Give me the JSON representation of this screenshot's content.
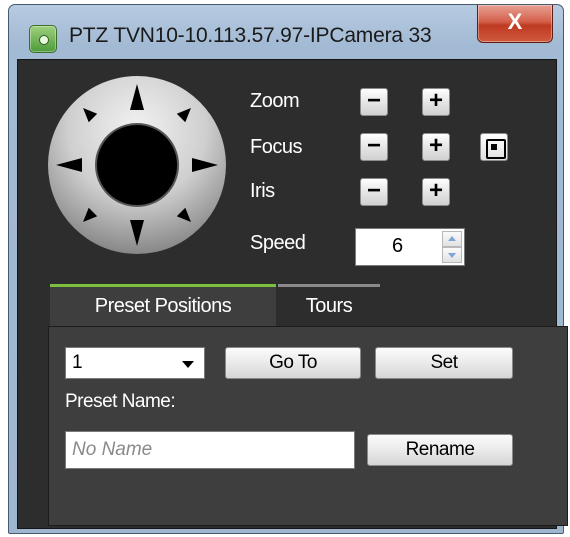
{
  "window": {
    "title": "PTZ  TVN10-10.113.57.97-IPCamera 33",
    "close_label": "X"
  },
  "joystick": {
    "directions": [
      "up",
      "down",
      "left",
      "right",
      "up-left",
      "up-right",
      "down-left",
      "down-right"
    ]
  },
  "controls": {
    "zoom_label": "Zoom",
    "focus_label": "Focus",
    "iris_label": "Iris",
    "speed_label": "Speed",
    "minus_label": "−",
    "plus_label": "+",
    "speed_value": "6"
  },
  "tabs": [
    {
      "label": "Preset Positions",
      "active": true
    },
    {
      "label": "Tours",
      "active": false
    }
  ],
  "preset": {
    "selected": "1",
    "goto_label": "Go To",
    "set_label": "Set",
    "name_label": "Preset Name:",
    "name_placeholder": "No Name",
    "name_value": "",
    "rename_label": "Rename"
  },
  "colors": {
    "accent": "#7bbf3e",
    "panel_bg": "#2d2d2d",
    "tab_bg": "#3e3e3e"
  },
  "icons": {
    "app": "camera-app-icon",
    "focus_auto": "autofocus-icon",
    "close": "close-icon",
    "spin_up": "spin-up-icon",
    "spin_down": "spin-down-icon",
    "dropdown": "chevron-down-icon"
  }
}
